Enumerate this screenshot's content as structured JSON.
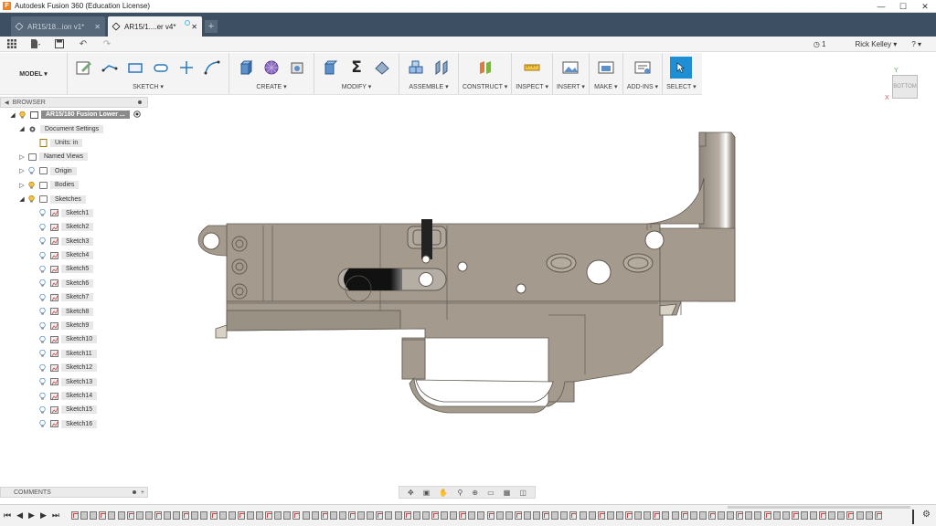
{
  "window": {
    "title": "Autodesk Fusion 360 (Education License)"
  },
  "tabs": [
    {
      "label": "AR15/18...ion v1*",
      "active": false
    },
    {
      "label": "AR15/1....er v4*",
      "active": true
    }
  ],
  "qat": {
    "notifications": "1",
    "user": "Rick Kelley ▾",
    "help": "? ▾"
  },
  "toolbar": {
    "model_label": "MODEL ▾",
    "groups": [
      {
        "label": "SKETCH ▾"
      },
      {
        "label": "CREATE ▾"
      },
      {
        "label": "MODIFY ▾"
      },
      {
        "label": "ASSEMBLE ▾"
      },
      {
        "label": "CONSTRUCT ▾"
      },
      {
        "label": "INSPECT ▾"
      },
      {
        "label": "INSERT ▾"
      },
      {
        "label": "MAKE ▾"
      },
      {
        "label": "ADD-INS ▾"
      },
      {
        "label": "SELECT ▾"
      }
    ]
  },
  "viewcube": {
    "face": "BOTTOM",
    "x": "X",
    "y": "Y"
  },
  "browser": {
    "header": "BROWSER",
    "root": "AR15/180 Fusion Lower ...",
    "doc_settings": "Document Settings",
    "units": "Units: in",
    "named_views": "Named Views",
    "origin": "Origin",
    "bodies": "Bodies",
    "sketches": "Sketches",
    "sketch_items": [
      "Sketch1",
      "Sketch2",
      "Sketch3",
      "Sketch4",
      "Sketch5",
      "Sketch6",
      "Sketch7",
      "Sketch8",
      "Sketch9",
      "Sketch10",
      "Sketch11",
      "Sketch12",
      "Sketch13",
      "Sketch14",
      "Sketch15",
      "Sketch16"
    ]
  },
  "comments": {
    "header": "COMMENTS"
  },
  "colors": {
    "tabbar": "#3d4f62",
    "part": "#a49b8e",
    "select_accent": "#1e8fd4"
  }
}
